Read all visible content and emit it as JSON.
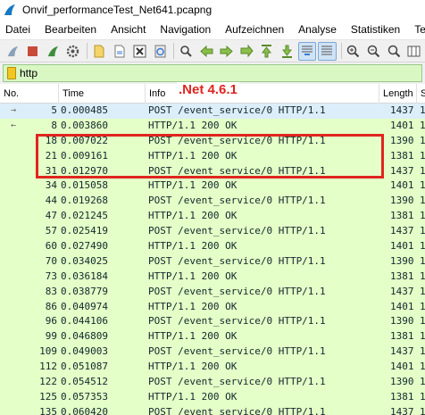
{
  "window": {
    "title": "Onvif_performanceTest_Net641.pcapng"
  },
  "menu": {
    "items": [
      "Datei",
      "Bearbeiten",
      "Ansicht",
      "Navigation",
      "Aufzeichnen",
      "Analyse",
      "Statistiken",
      "Tel"
    ]
  },
  "toolbar": {
    "buttons": [
      "shark-fin-start-icon",
      "stop-square-icon",
      "restart-fin-icon",
      "gear-options-icon",
      "open-file-icon",
      "save-file-icon",
      "close-file-icon",
      "reload-icon",
      "find-packet-icon",
      "go-back-icon",
      "go-forward-icon",
      "go-to-packet-icon",
      "go-first-icon",
      "go-last-icon",
      "autoscroll-icon",
      "colorize-icon",
      "zoom-in-icon",
      "zoom-out-icon",
      "zoom-normal-icon",
      "resize-columns-icon"
    ]
  },
  "filter": {
    "value": "http"
  },
  "columns": {
    "no": "No.",
    "time": "Time",
    "info": "Info",
    "length": "Length",
    "extra": "S"
  },
  "annotation": {
    "label": ".Net 4.6.1"
  },
  "packets": [
    {
      "arrow": "→",
      "no": "5",
      "time": "0.000485",
      "info": "POST /event_service/0 HTTP/1.1",
      "length": "1437",
      "extra": "1"
    },
    {
      "arrow": "←",
      "no": "8",
      "time": "0.003860",
      "info": "HTTP/1.1 200 OK",
      "length": "1401",
      "extra": "1"
    },
    {
      "arrow": "",
      "no": "18",
      "time": "0.007022",
      "info": "POST /event_service/0 HTTP/1.1",
      "length": "1390",
      "extra": "1"
    },
    {
      "arrow": "",
      "no": "21",
      "time": "0.009161",
      "info": "HTTP/1.1 200 OK",
      "length": "1381",
      "extra": "1"
    },
    {
      "arrow": "",
      "no": "31",
      "time": "0.012970",
      "info": "POST /event_service/0 HTTP/1.1",
      "length": "1437",
      "extra": "1"
    },
    {
      "arrow": "",
      "no": "34",
      "time": "0.015058",
      "info": "HTTP/1.1 200 OK",
      "length": "1401",
      "extra": "1"
    },
    {
      "arrow": "",
      "no": "44",
      "time": "0.019268",
      "info": "POST /event_service/0 HTTP/1.1",
      "length": "1390",
      "extra": "1"
    },
    {
      "arrow": "",
      "no": "47",
      "time": "0.021245",
      "info": "HTTP/1.1 200 OK",
      "length": "1381",
      "extra": "1"
    },
    {
      "arrow": "",
      "no": "57",
      "time": "0.025419",
      "info": "POST /event_service/0 HTTP/1.1",
      "length": "1437",
      "extra": "1"
    },
    {
      "arrow": "",
      "no": "60",
      "time": "0.027490",
      "info": "HTTP/1.1 200 OK",
      "length": "1401",
      "extra": "1"
    },
    {
      "arrow": "",
      "no": "70",
      "time": "0.034025",
      "info": "POST /event_service/0 HTTP/1.1",
      "length": "1390",
      "extra": "1"
    },
    {
      "arrow": "",
      "no": "73",
      "time": "0.036184",
      "info": "HTTP/1.1 200 OK",
      "length": "1381",
      "extra": "1"
    },
    {
      "arrow": "",
      "no": "83",
      "time": "0.038779",
      "info": "POST /event_service/0 HTTP/1.1",
      "length": "1437",
      "extra": "1"
    },
    {
      "arrow": "",
      "no": "86",
      "time": "0.040974",
      "info": "HTTP/1.1 200 OK",
      "length": "1401",
      "extra": "1"
    },
    {
      "arrow": "",
      "no": "96",
      "time": "0.044106",
      "info": "POST /event_service/0 HTTP/1.1",
      "length": "1390",
      "extra": "1"
    },
    {
      "arrow": "",
      "no": "99",
      "time": "0.046809",
      "info": "HTTP/1.1 200 OK",
      "length": "1381",
      "extra": "1"
    },
    {
      "arrow": "",
      "no": "109",
      "time": "0.049003",
      "info": "POST /event_service/0 HTTP/1.1",
      "length": "1437",
      "extra": "1"
    },
    {
      "arrow": "",
      "no": "112",
      "time": "0.051087",
      "info": "HTTP/1.1 200 OK",
      "length": "1401",
      "extra": "1"
    },
    {
      "arrow": "",
      "no": "122",
      "time": "0.054512",
      "info": "POST /event_service/0 HTTP/1.1",
      "length": "1390",
      "extra": "1"
    },
    {
      "arrow": "",
      "no": "125",
      "time": "0.057353",
      "info": "HTTP/1.1 200 OK",
      "length": "1381",
      "extra": "1"
    },
    {
      "arrow": "",
      "no": "135",
      "time": "0.060420",
      "info": "POST /event_service/0 HTTP/1.1",
      "length": "1437",
      "extra": "1"
    }
  ]
}
